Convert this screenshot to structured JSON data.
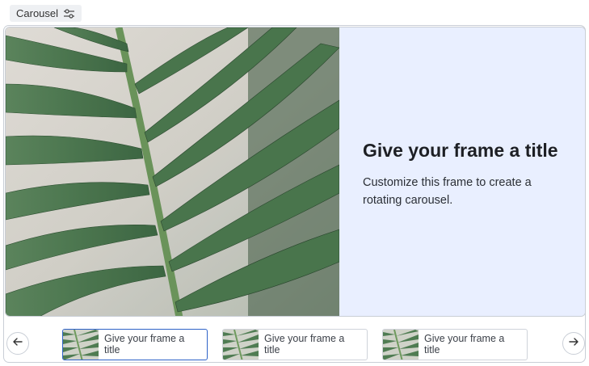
{
  "header": {
    "chip_label": "Carousel",
    "chip_icon": "sliders-icon"
  },
  "slide": {
    "title": "Give your frame a title",
    "description": "Customize this frame to create a rotating carousel.",
    "image": "palm-leaf-photo",
    "text_panel_color": "#e9efff"
  },
  "navigation": {
    "prev_icon": "arrow-left-icon",
    "next_icon": "arrow-right-icon"
  },
  "thumbnails": [
    {
      "label": "Give your frame a title",
      "active": true
    },
    {
      "label": "Give your frame a title",
      "active": false
    },
    {
      "label": "Give your frame a title",
      "active": false
    }
  ],
  "colors": {
    "active_border": "#2f63c8",
    "frame_border": "#c9ced6"
  }
}
